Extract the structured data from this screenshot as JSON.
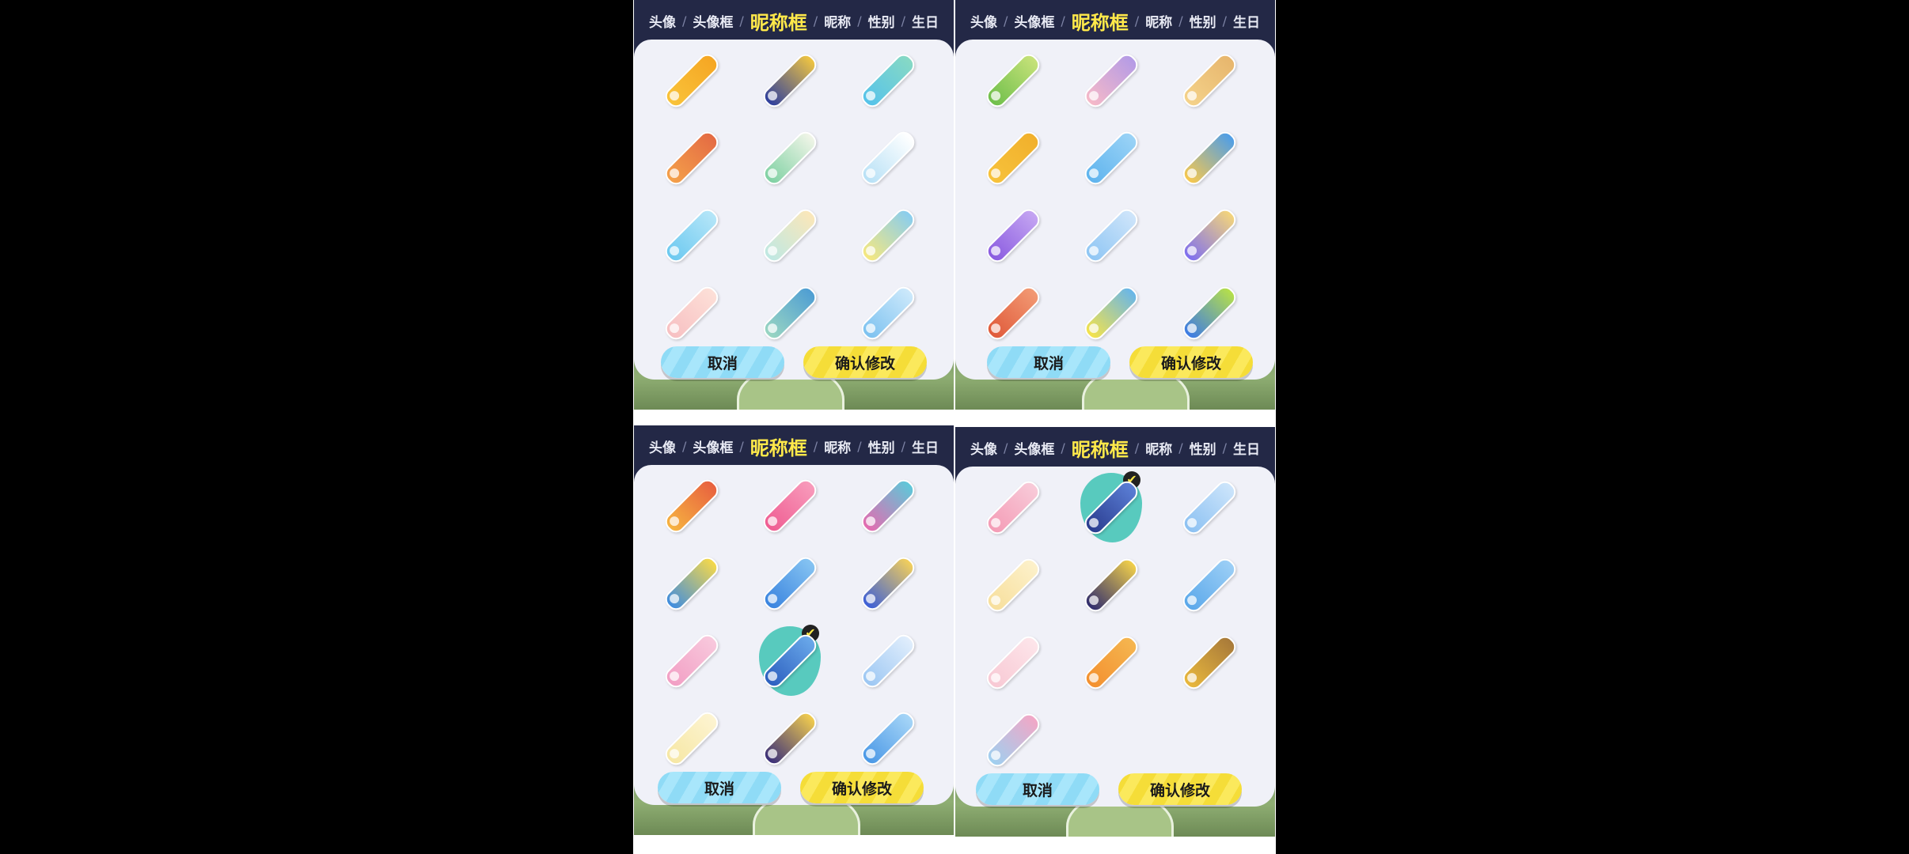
{
  "panels": [
    {
      "tabs": [
        "头像",
        "头像框",
        "昵称框",
        "昵称",
        "性别",
        "生日"
      ],
      "active_tab": 2,
      "cancel_label": "取消",
      "confirm_label": "确认修改",
      "frames": [
        {
          "name": "nickname-frame-1",
          "colors": [
            "#f9c33a",
            "#f5a623"
          ]
        },
        {
          "name": "nickname-frame-2",
          "colors": [
            "#2e3f9e",
            "#f0c541"
          ]
        },
        {
          "name": "nickname-frame-3",
          "colors": [
            "#56c3ea",
            "#87d9c4"
          ]
        },
        {
          "name": "nickname-frame-4",
          "colors": [
            "#f4a04a",
            "#e46b43"
          ]
        },
        {
          "name": "nickname-frame-5",
          "colors": [
            "#7fd1a3",
            "#f1f5e8"
          ]
        },
        {
          "name": "nickname-frame-6",
          "colors": [
            "#b8e1f6",
            "#ffffff"
          ]
        },
        {
          "name": "nickname-frame-7",
          "colors": [
            "#6cc9f0",
            "#b6e6f8"
          ]
        },
        {
          "name": "nickname-frame-8",
          "colors": [
            "#bfe8e3",
            "#fbe7b9"
          ]
        },
        {
          "name": "nickname-frame-9",
          "colors": [
            "#f6e87f",
            "#89cdef"
          ]
        },
        {
          "name": "nickname-frame-10",
          "colors": [
            "#f7c0c2",
            "#fde0d8"
          ]
        },
        {
          "name": "nickname-frame-11",
          "colors": [
            "#9ad6c2",
            "#4f9ed3"
          ]
        },
        {
          "name": "nickname-frame-12",
          "colors": [
            "#7dc2f0",
            "#cde9fb"
          ]
        }
      ]
    },
    {
      "tabs": [
        "头像",
        "头像框",
        "昵称框",
        "昵称",
        "性别",
        "生日"
      ],
      "active_tab": 2,
      "cancel_label": "取消",
      "confirm_label": "确认修改",
      "frames": [
        {
          "name": "nickname-frame-13",
          "colors": [
            "#6fbf4b",
            "#c7e27a"
          ]
        },
        {
          "name": "nickname-frame-14",
          "colors": [
            "#f6b9c8",
            "#b49be6"
          ]
        },
        {
          "name": "nickname-frame-15",
          "colors": [
            "#f4d28a",
            "#e7b66d"
          ]
        },
        {
          "name": "nickname-frame-16",
          "colors": [
            "#f7c23b",
            "#f1b02c"
          ]
        },
        {
          "name": "nickname-frame-17",
          "colors": [
            "#5fb4ee",
            "#9bd3f6"
          ]
        },
        {
          "name": "nickname-frame-18",
          "colors": [
            "#f7c84e",
            "#4e9ee8"
          ]
        },
        {
          "name": "nickname-frame-19",
          "colors": [
            "#8a5be0",
            "#c5a6f2"
          ]
        },
        {
          "name": "nickname-frame-20",
          "colors": [
            "#8fc6f4",
            "#cfe5fa"
          ]
        },
        {
          "name": "nickname-frame-21",
          "colors": [
            "#7f6ff0",
            "#f4d57b"
          ]
        },
        {
          "name": "nickname-frame-22",
          "colors": [
            "#e05a3a",
            "#f29a74"
          ]
        },
        {
          "name": "nickname-frame-23",
          "colors": [
            "#f5e34a",
            "#68b6ea"
          ]
        },
        {
          "name": "nickname-frame-24",
          "colors": [
            "#3d7be6",
            "#b6e04a"
          ]
        }
      ]
    },
    {
      "tabs": [
        "头像",
        "头像框",
        "昵称框",
        "昵称",
        "性别",
        "生日"
      ],
      "active_tab": 2,
      "cancel_label": "取消",
      "confirm_label": "确认修改",
      "selected_index": 7,
      "frames": [
        {
          "name": "nickname-frame-25",
          "colors": [
            "#f6b340",
            "#e8613f"
          ]
        },
        {
          "name": "nickname-frame-26",
          "colors": [
            "#ef5d92",
            "#f89bbb"
          ]
        },
        {
          "name": "nickname-frame-27",
          "colors": [
            "#e56bb0",
            "#5ec8d9"
          ]
        },
        {
          "name": "nickname-frame-28",
          "colors": [
            "#3f8de0",
            "#f6d94a"
          ]
        },
        {
          "name": "nickname-frame-29",
          "colors": [
            "#3a84df",
            "#86c4f2"
          ]
        },
        {
          "name": "nickname-frame-30",
          "colors": [
            "#3c5fd8",
            "#f3cf5b"
          ]
        },
        {
          "name": "nickname-frame-31",
          "colors": [
            "#f29fc4",
            "#f8c9dd"
          ]
        },
        {
          "name": "nickname-frame-32",
          "colors": [
            "#2c5fbf",
            "#6aa9ea"
          ]
        },
        {
          "name": "nickname-frame-33",
          "colors": [
            "#9cc7f3",
            "#e1eefc"
          ]
        },
        {
          "name": "nickname-frame-34",
          "colors": [
            "#f6e7a4",
            "#fdf4d2"
          ]
        },
        {
          "name": "nickname-frame-35",
          "colors": [
            "#3a2f7a",
            "#f2cd4e"
          ]
        },
        {
          "name": "nickname-frame-36",
          "colors": [
            "#4a98e6",
            "#a7d6f7"
          ]
        }
      ]
    },
    {
      "tabs": [
        "头像",
        "头像框",
        "昵称框",
        "昵称",
        "性别",
        "生日"
      ],
      "active_tab": 2,
      "cancel_label": "取消",
      "confirm_label": "确认修改",
      "selected_index": 1,
      "frames": [
        {
          "name": "nickname-frame-37",
          "colors": [
            "#f49cb6",
            "#f8cbd9"
          ]
        },
        {
          "name": "nickname-frame-38",
          "colors": [
            "#2a3c8f",
            "#5b7fd6"
          ]
        },
        {
          "name": "nickname-frame-39",
          "colors": [
            "#8cc1f2",
            "#cde5fb"
          ]
        },
        {
          "name": "nickname-frame-40",
          "colors": [
            "#f7df9c",
            "#fdf1cb"
          ]
        },
        {
          "name": "nickname-frame-41",
          "colors": [
            "#2f2c6e",
            "#f2d04a"
          ]
        },
        {
          "name": "nickname-frame-42",
          "colors": [
            "#5ba8ea",
            "#9ccff6"
          ]
        },
        {
          "name": "nickname-frame-43",
          "colors": [
            "#f8c9d4",
            "#fde5ea"
          ]
        },
        {
          "name": "nickname-frame-44",
          "colors": [
            "#f3902f",
            "#f5b650"
          ]
        },
        {
          "name": "nickname-frame-45",
          "colors": [
            "#e9b83d",
            "#a87a3a"
          ]
        },
        {
          "name": "nickname-frame-46",
          "colors": [
            "#9fd0f0",
            "#f2a7c6"
          ]
        }
      ]
    }
  ]
}
